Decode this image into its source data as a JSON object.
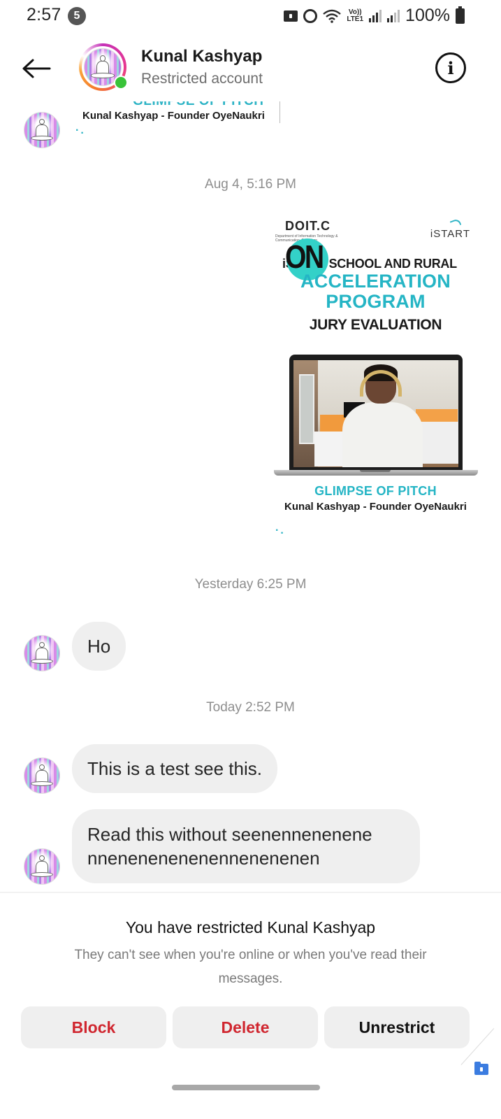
{
  "status_bar": {
    "time": "2:57",
    "notification_count": "5",
    "network_label_top": "Vo))",
    "network_label_bottom": "LTE1",
    "battery": "100%"
  },
  "header": {
    "contact_name": "Kunal Kashyap",
    "subtitle": "Restricted account",
    "online": true
  },
  "conversation": {
    "partial_post": {
      "headline_fragment": "GLIMPSE OF PITCH",
      "caption": "Kunal Kashyap - Founder OyeNaukri"
    },
    "timestamps": [
      "Aug 4, 5:16 PM",
      "Yesterday 6:25 PM",
      "Today 2:52 PM"
    ],
    "shared_post": {
      "logo_left": "DOIT.C",
      "logo_left_sub": "Department of Information Technology & Communication, Rajasthan",
      "logo_right": "iSTART",
      "sticker_text": "ON",
      "program_line": "iSTART SCHOOL AND RURAL",
      "program_line_visible_start": "iS",
      "program_line_visible_end": "T SCHOOL AND RURAL",
      "title_line1": "ACCELERATION",
      "title_line2": "PROGRAM",
      "subtitle": "JURY EVALUATION",
      "headline": "GLIMPSE OF PITCH",
      "caption": "Kunal Kashyap - Founder OyeNaukri"
    },
    "messages": [
      {
        "sender": "Kunal Kashyap",
        "text": "Ho"
      },
      {
        "sender": "Kunal Kashyap",
        "text": "This is a test see this."
      },
      {
        "sender": "Kunal Kashyap",
        "text_line1": "Read this without seenennenenene",
        "text_line2": "nnenenenenenennenenenen",
        "text": "Read this without seenennenenenennenenenenenennenenenen"
      }
    ]
  },
  "restriction_notice": {
    "title": "You have restricted Kunal Kashyap",
    "description": "They can't see when you're online or when you've read their messages.",
    "buttons": {
      "block": "Block",
      "delete": "Delete",
      "unrestrict": "Unrestrict"
    }
  },
  "colors": {
    "destructive": "#d0262f",
    "accent_cyan": "#25b5c5",
    "online_green": "#39c339",
    "bubble_bg": "#efefef",
    "timestamp_gray": "#8e8e8e"
  }
}
